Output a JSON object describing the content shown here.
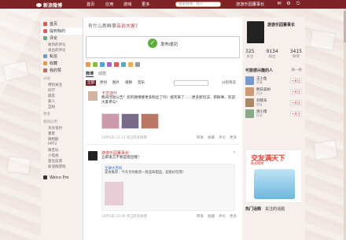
{
  "topbar": {
    "logo": "新浪微博",
    "nav": [
      "首页",
      "应用",
      "游戏",
      "更多"
    ],
    "search_placeholder": "搜索微博、找人",
    "user": "游游乐园董事长"
  },
  "leftnav": {
    "items": [
      {
        "label": "首页",
        "icon": "home-icon",
        "color": "#d55"
      },
      {
        "label": "提到我的",
        "icon": "at-icon",
        "color": "#e55",
        "active": true
      },
      {
        "label": "评论",
        "icon": "comment-icon",
        "color": "#6a8"
      },
      {
        "label": "私信",
        "icon": "message-icon",
        "color": "#79c"
      },
      {
        "label": "收藏",
        "icon": "star-icon",
        "color": "#e93"
      },
      {
        "label": "我的赞",
        "icon": "like-icon",
        "color": "#c66"
      }
    ],
    "sub_items": [
      "收到的评论",
      "发出的评论",
      "我的投票"
    ],
    "section_group": "分组",
    "groups": [
      "特别关注",
      "同学",
      "朋友",
      "家人",
      "互粉"
    ],
    "section_more": "更多",
    "section_apps": "我的应用",
    "apps": [
      "天天有约",
      "墨客",
      "微相册",
      "PPTV",
      "微音乐",
      "小电视",
      "意见反馈",
      "新浪微游戏"
    ],
    "footer": "Weico Pro"
  },
  "main": {
    "question_prefix": "有什么新鲜事",
    "question_highlight": "告诉大家",
    "question_suffix": "?",
    "success_text": "发布成功",
    "tabs": [
      "微博",
      "动态"
    ],
    "filters": [
      "全部",
      "原创",
      "图片",
      "视频",
      "音乐"
    ],
    "filter_extra": "分组筛选",
    "tool_colors": [
      "#e94",
      "#8b4",
      "#4ad",
      "#a6c",
      "#e55",
      "#5ab",
      "#fa4",
      "#999"
    ],
    "posts": [
      {
        "author": "卡文迪什",
        "text": "晚间活动公告！您的微博要更多粉丝了吗！搞笑来了……更多新玩法、新鲜事，欢迎大家参与！",
        "time": "10月5日 23:11 来自新浪微博",
        "actions": [
          "转发",
          "收藏",
          "评论",
          "更多"
        ]
      },
      {
        "author": "游游乐园董事长",
        "text": "立即发言不要是唱出哦！",
        "time": "10月5日 23:06 来自新浪微博",
        "repost_author": "全球大百科",
        "repost_text": "美食推荐：今天为你推荐一款美味甜品，超级好吃哦！",
        "actions": [
          "转发",
          "收藏",
          "评论",
          "更多"
        ]
      }
    ]
  },
  "right": {
    "name": "游游乐园董事长",
    "stats": [
      {
        "num": "325",
        "label": "关注"
      },
      {
        "num": "9134",
        "label": "粉丝"
      },
      {
        "num": "3415",
        "label": "微博"
      }
    ],
    "may_know": "可能感兴趣的人",
    "change": "换一换",
    "people": [
      {
        "name": "王小鱼",
        "desc": "同事",
        "color": "#79c"
      },
      {
        "name": "明日美树",
        "desc": "同学",
        "color": "#c97"
      },
      {
        "name": "刘晓东",
        "desc": "朋友",
        "color": "#a86"
      },
      {
        "name": "周小雨",
        "desc": "同学",
        "color": "#8a8"
      }
    ],
    "follow": "+关注",
    "ad_big": "交友满天下",
    "ad_sub": "新浪微博",
    "hot_tabs": [
      "热门话题",
      "关注的话题"
    ]
  }
}
